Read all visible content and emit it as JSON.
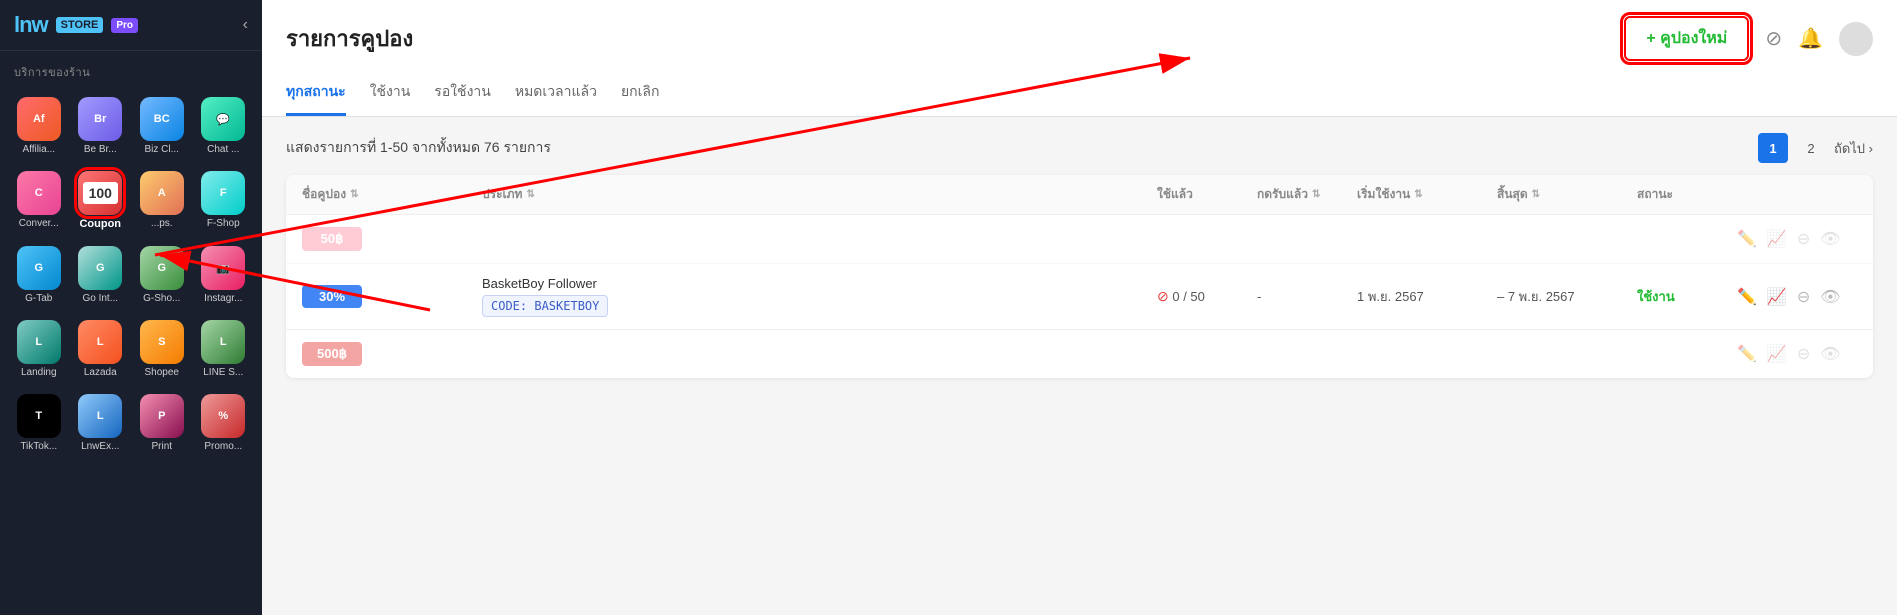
{
  "sidebar": {
    "logo": "lnw",
    "store_label": "STORE",
    "pro_label": "Pro",
    "collapse_icon": "‹",
    "section_title": "บริการของร้าน",
    "apps": [
      {
        "id": "affiliate",
        "label": "Affilia...",
        "icon_class": "icon-affiliate",
        "text": "Af"
      },
      {
        "id": "brand",
        "label": "Be Br...",
        "icon_class": "icon-brand",
        "text": "Br"
      },
      {
        "id": "bizclass",
        "label": "Biz Cl...",
        "icon_class": "icon-bizclass",
        "text": "BC"
      },
      {
        "id": "chat",
        "label": "Chat ...",
        "icon_class": "icon-chat",
        "text": "💬"
      },
      {
        "id": "conversion",
        "label": "Conver...",
        "icon_class": "icon-conversion",
        "text": "C"
      },
      {
        "id": "coupon",
        "label": "Coupon",
        "icon_class": "icon-coupon",
        "text": "100",
        "highlighted": true
      },
      {
        "id": "apps",
        "label": "...ps.",
        "icon_class": "icon-apps",
        "text": "A"
      },
      {
        "id": "fshop",
        "label": "F-Shop",
        "icon_class": "icon-fshop",
        "text": "F"
      },
      {
        "id": "gtab",
        "label": "G-Tab",
        "icon_class": "icon-gtab",
        "text": "G"
      },
      {
        "id": "goint",
        "label": "Go Int...",
        "icon_class": "icon-goint",
        "text": "G"
      },
      {
        "id": "gsho",
        "label": "G-Sho...",
        "icon_class": "icon-gsho",
        "text": "G"
      },
      {
        "id": "instagram",
        "label": "Instagr...",
        "icon_class": "icon-instagram",
        "text": "📷"
      },
      {
        "id": "landing",
        "label": "Landing",
        "icon_class": "icon-landing",
        "text": "L"
      },
      {
        "id": "lazada",
        "label": "Lazada",
        "icon_class": "icon-lazada",
        "text": "L"
      },
      {
        "id": "shopee",
        "label": "Shopee",
        "icon_class": "icon-shopee",
        "text": "S"
      },
      {
        "id": "lines",
        "label": "LINE S...",
        "icon_class": "icon-lines",
        "text": "L"
      },
      {
        "id": "tiktok",
        "label": "TikTok...",
        "icon_class": "icon-tiktok",
        "text": "T"
      },
      {
        "id": "lnwex",
        "label": "LnwEx...",
        "icon_class": "icon-lnwex",
        "text": "L"
      },
      {
        "id": "print",
        "label": "Print",
        "icon_class": "icon-print",
        "text": "P"
      },
      {
        "id": "promo",
        "label": "Promo...",
        "icon_class": "icon-promo",
        "text": "%"
      }
    ]
  },
  "header": {
    "page_title": "รายการคูปอง",
    "new_coupon_label": "+ คูปองใหม่",
    "filter_icon": "filter",
    "bell_icon": "bell"
  },
  "tabs": [
    {
      "id": "all",
      "label": "ทุกสถานะ",
      "active": true
    },
    {
      "id": "active",
      "label": "ใช้งาน",
      "active": false
    },
    {
      "id": "waiting",
      "label": "รอใช้งาน",
      "active": false
    },
    {
      "id": "expired",
      "label": "หมดเวลาแล้ว",
      "active": false
    },
    {
      "id": "cancelled",
      "label": "ยกเลิก",
      "active": false
    }
  ],
  "table": {
    "info_text": "แสดงรายการที่ 1-50 จากทั้งหมด 76 รายการ",
    "pagination": {
      "page1": "1",
      "page2": "2",
      "next_label": "ถัดไป ›"
    },
    "columns": [
      {
        "id": "name",
        "label": "ชื่อคูปอง"
      },
      {
        "id": "type",
        "label": "ประเภท"
      },
      {
        "id": "used",
        "label": "ใช้แล้ว"
      },
      {
        "id": "redeemed",
        "label": "กดรับแล้ว"
      },
      {
        "id": "start",
        "label": "เริ่มใช้งาน"
      },
      {
        "id": "end",
        "label": "สิ้นสุด"
      },
      {
        "id": "status",
        "label": "สถานะ"
      },
      {
        "id": "actions",
        "label": ""
      }
    ],
    "rows": [
      {
        "badge_text": "50฿",
        "badge_class": "badge-pink",
        "name": "",
        "type": "",
        "used": "",
        "redeemed": "",
        "start": "",
        "end": "",
        "status": "",
        "dimmed": true
      },
      {
        "badge_text": "30%",
        "badge_class": "badge-blue",
        "name": "BasketBoy Follower",
        "code": "CODE: BASKETBOY",
        "used": "0 / 50",
        "redeemed": "-",
        "start": "1 พ.ย. 2567",
        "end": "– 7 พ.ย. 2567",
        "status": "ใช้งาน",
        "status_class": "status-active",
        "dimmed": false
      },
      {
        "badge_text": "500฿",
        "badge_class": "badge-red",
        "name": "",
        "type": "",
        "used": "",
        "redeemed": "",
        "start": "",
        "end": "",
        "status": "",
        "dimmed": true
      }
    ]
  }
}
